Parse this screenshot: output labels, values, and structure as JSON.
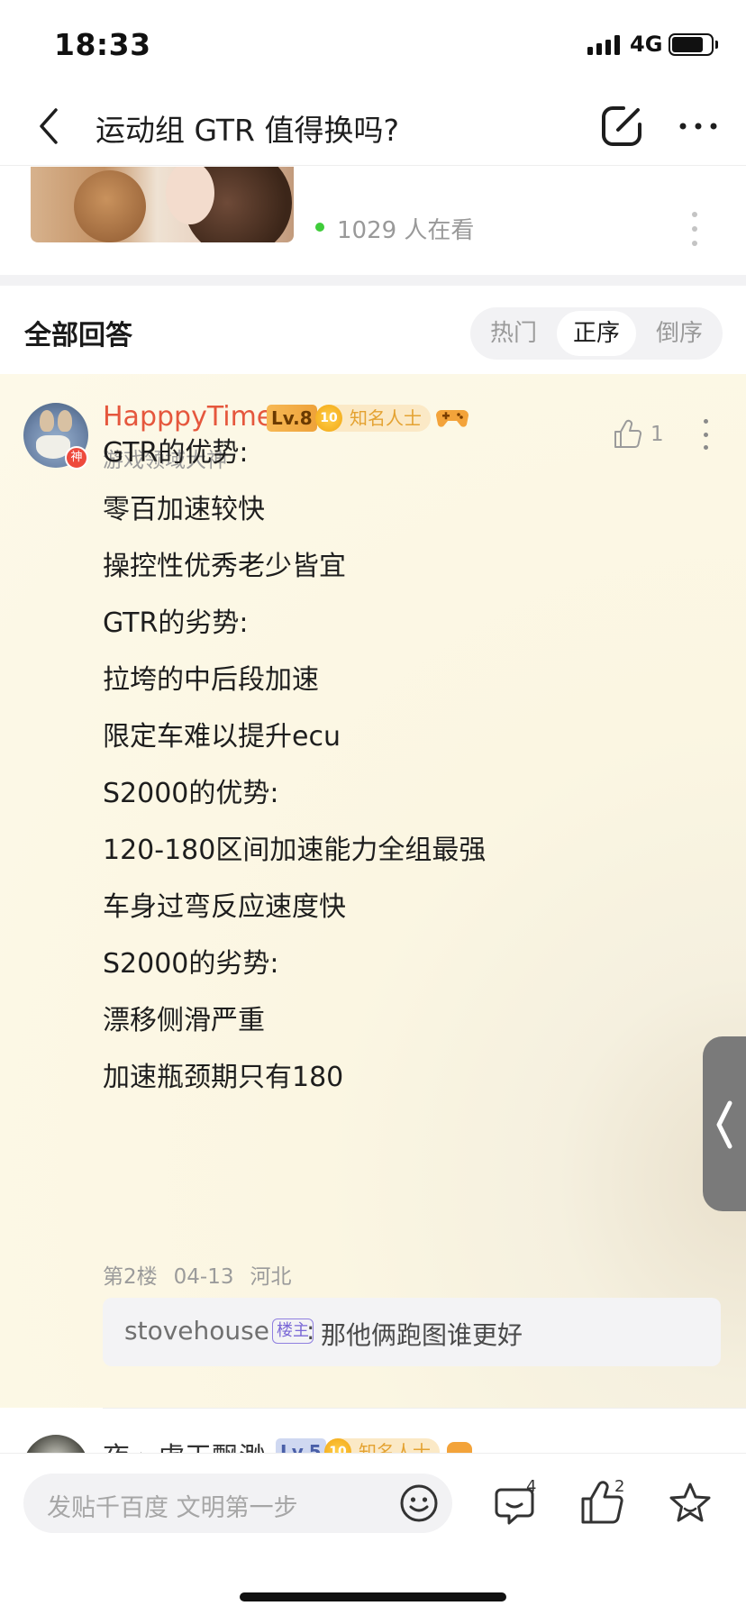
{
  "status_bar": {
    "time": "18:33",
    "network": "4G",
    "icons": [
      "signal-icon",
      "battery-icon"
    ]
  },
  "nav": {
    "title": "运动组 GTR 值得换吗?",
    "icons": [
      "back-icon",
      "edit-icon",
      "more-icon"
    ]
  },
  "live_banner": {
    "viewers": "1029 人在看",
    "dot_color": "#3fcc3a"
  },
  "answers": {
    "title": "全部回答",
    "sort_tabs": [
      {
        "label": "热门",
        "active": false
      },
      {
        "label": "正序",
        "active": true
      },
      {
        "label": "倒序",
        "active": false
      }
    ]
  },
  "reply": {
    "username": "HapppyTime",
    "username_color": "#e5573d",
    "level": "Lv.8",
    "badge": "神",
    "honor_level": "10",
    "honor_title": "知名人士",
    "subtitle": "游戏领域大神",
    "likes": "1",
    "content": [
      "GTR的优势:",
      "零百加速较快",
      "操控性优秀老少皆宜",
      "GTR的劣势:",
      "拉垮的中后段加速",
      "限定车难以提升ecu",
      "S2000的优势:",
      "120-180区间加速能力全组最强",
      "车身过弯反应速度快",
      "S2000的劣势:",
      "漂移侧滑严重",
      "加速瓶颈期只有180"
    ],
    "meta": {
      "floor": "第2楼",
      "date": "04-13",
      "location": "河北"
    },
    "sub_reply": {
      "user": "stovehouse",
      "tag": "楼主",
      "colon": ":",
      "text": "那他俩跑图谁更好"
    }
  },
  "next_reply": {
    "username": "夜 › 虐天飘渺",
    "level": "Lv.5",
    "honor_level": "10",
    "honor_title": "知名人士"
  },
  "bottom_bar": {
    "input_placeholder": "发贴千百度 文明第一步",
    "comment_count": "4",
    "like_count": "2",
    "icons": [
      "emoji-icon",
      "comment-icon",
      "thumbs-up-icon",
      "star-icon"
    ]
  }
}
